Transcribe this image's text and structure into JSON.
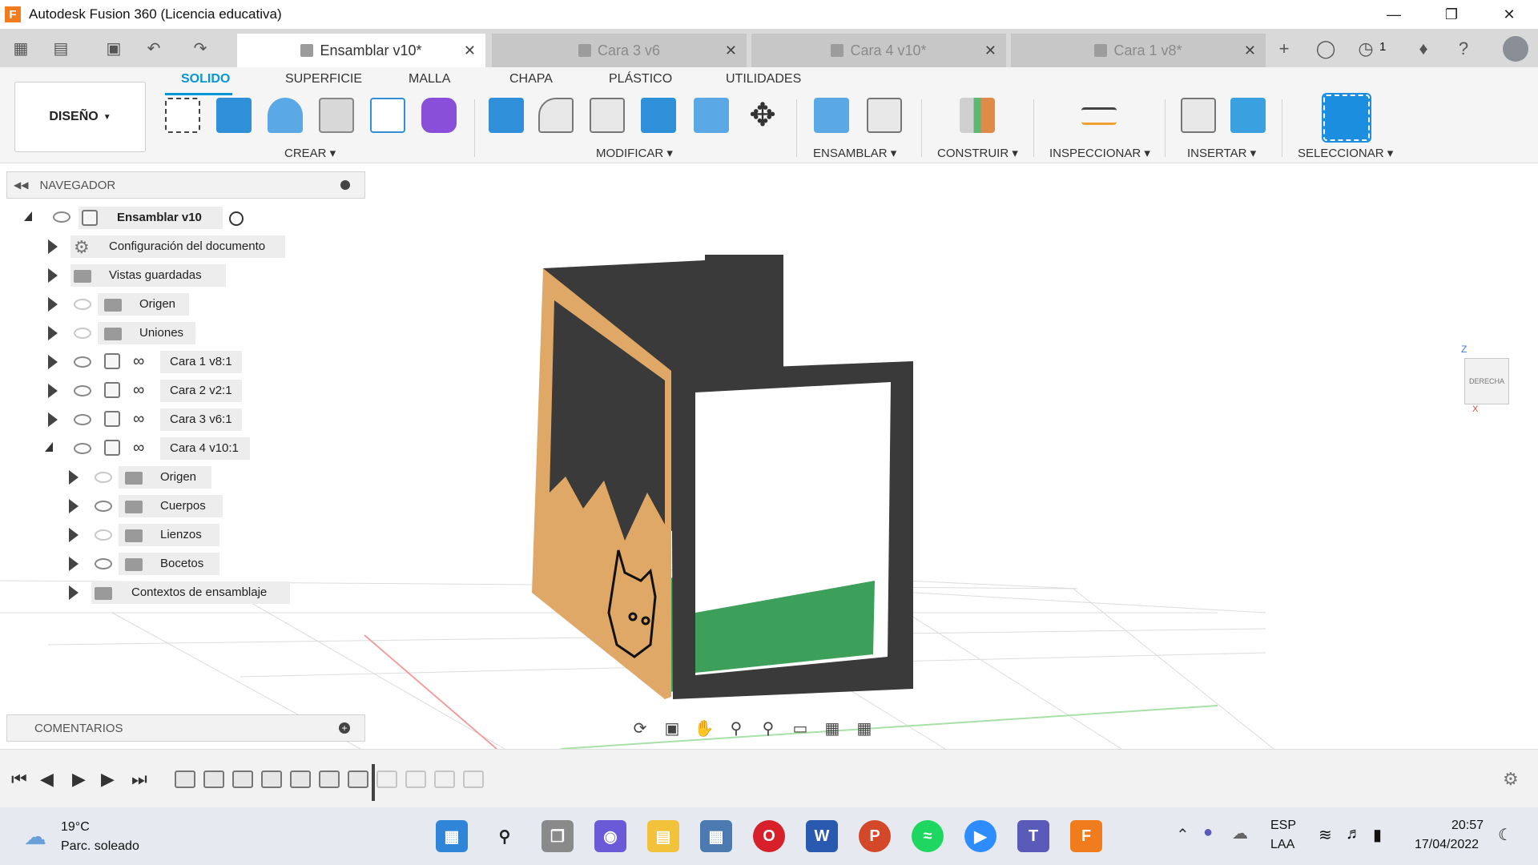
{
  "window": {
    "title": "Autodesk Fusion 360 (Licencia educativa)",
    "app_logo_letter": "F"
  },
  "tabs": [
    {
      "label": "Ensamblar v10*",
      "active": true
    },
    {
      "label": "Cara 3 v6",
      "active": false
    },
    {
      "label": "Cara 4 v10*",
      "active": false
    },
    {
      "label": "Cara 1 v8*",
      "active": false
    }
  ],
  "header_right": {
    "job_count": "1"
  },
  "toolbar": {
    "workspace": "DISEÑO",
    "workspace_tabs": [
      "SOLIDO",
      "SUPERFICIE",
      "MALLA",
      "CHAPA",
      "PLÁSTICO",
      "UTILIDADES"
    ],
    "groups": [
      "CREAR",
      "MODIFICAR",
      "ENSAMBLAR",
      "CONSTRUIR",
      "INSPECCIONAR",
      "INSERTAR",
      "SELECCIONAR"
    ]
  },
  "browser": {
    "header": "NAVEGADOR",
    "root": "Ensamblar v10",
    "items": [
      {
        "label": "Configuración del documento",
        "icon": "gear-icon"
      },
      {
        "label": "Vistas guardadas",
        "icon": "folder-icon"
      },
      {
        "label": "Origen",
        "icon": "folder-icon",
        "visible": false
      },
      {
        "label": "Uniones",
        "icon": "folder-icon",
        "visible": false
      },
      {
        "label": "Cara 1 v8:1",
        "icon": "component-icon",
        "visible": true
      },
      {
        "label": "Cara 2 v2:1",
        "icon": "component-icon",
        "visible": true
      },
      {
        "label": "Cara 3 v6:1",
        "icon": "component-icon",
        "visible": true
      },
      {
        "label": "Cara 4 v10:1",
        "icon": "component-icon",
        "visible": true,
        "expanded": true
      }
    ],
    "children": [
      {
        "label": "Origen",
        "visible": false
      },
      {
        "label": "Cuerpos",
        "visible": true
      },
      {
        "label": "Lienzos",
        "visible": false
      },
      {
        "label": "Bocetos",
        "visible": true
      },
      {
        "label": "Contextos de ensamblaje"
      }
    ]
  },
  "comments": {
    "header": "COMENTARIOS"
  },
  "viewcube": {
    "face_label": "DERECHA",
    "axis_z": "Z",
    "axis_x": "X"
  },
  "colors": {
    "accent": "#0696d7",
    "panel_dark": "#3a3a3a",
    "panel_orange": "#e0a866",
    "floor_green": "#3da05a"
  },
  "taskbar": {
    "weather_temp": "19°C",
    "weather_desc": "Parc. soleado",
    "lang1": "ESP",
    "lang2": "LAA",
    "time": "20:57",
    "date": "17/04/2022"
  }
}
